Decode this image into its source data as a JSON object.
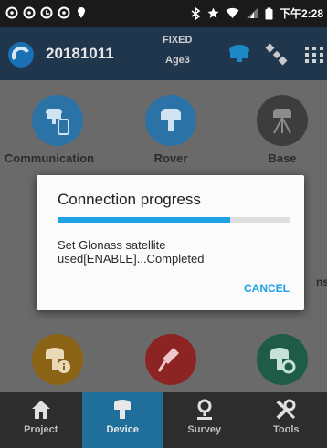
{
  "status_bar": {
    "time": "下午2:28",
    "icons": [
      "notification-icon",
      "notification-icon",
      "notification-icon",
      "notification-icon",
      "location-icon",
      "bluetooth-icon",
      "star-icon",
      "wifi-icon",
      "signal-icon",
      "battery-icon"
    ]
  },
  "header": {
    "project_name": "20181011",
    "fix_status": "FIXED",
    "age": "Age3"
  },
  "tiles": [
    {
      "label": "Communication",
      "color": "#2b73a7"
    },
    {
      "label": "Rover",
      "color": "#2b73a7"
    },
    {
      "label": "Base",
      "color": "#3d3d3d"
    },
    {
      "label": "",
      "color": "#8a6414"
    },
    {
      "label": "",
      "color": "#8c2424"
    },
    {
      "label": "",
      "color": "#1e5c48"
    }
  ],
  "partial_text": "ns",
  "bottom_nav": {
    "items": [
      {
        "label": "Project",
        "icon": "home-icon"
      },
      {
        "label": "Device",
        "icon": "rover-icon"
      },
      {
        "label": "Survey",
        "icon": "map-pin-icon"
      },
      {
        "label": "Tools",
        "icon": "tools-icon"
      }
    ],
    "active": "Device"
  },
  "dialog": {
    "title": "Connection progress",
    "progress": 0.74,
    "message": "Set Glonass satellite used[ENABLE]...Completed",
    "cancel_label": "CANCEL"
  },
  "colors": {
    "accent": "#1ea1e6",
    "active_tab": "#1f6f9a"
  }
}
